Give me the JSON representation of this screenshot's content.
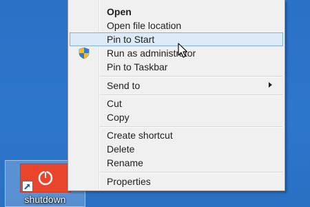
{
  "desktop": {
    "background_color": "#2b73c8",
    "icon": {
      "label": "shutdown",
      "tile_color": "#e8452c",
      "icon_name": "power-icon"
    }
  },
  "context_menu": {
    "items": [
      {
        "label": "Open",
        "bold": true
      },
      {
        "label": "Open file location"
      },
      {
        "label": "Pin to Start",
        "highlighted": true
      },
      {
        "label": "Run as administrator",
        "icon": "uac-shield-icon"
      },
      {
        "label": "Pin to Taskbar"
      },
      {
        "label": "Send to",
        "submenu": true
      },
      {
        "label": "Cut"
      },
      {
        "label": "Copy"
      },
      {
        "label": "Create shortcut"
      },
      {
        "label": "Delete"
      },
      {
        "label": "Rename"
      },
      {
        "label": "Properties"
      }
    ],
    "highlight_color": "#dcebf7",
    "highlight_border": "#82b0d8"
  }
}
